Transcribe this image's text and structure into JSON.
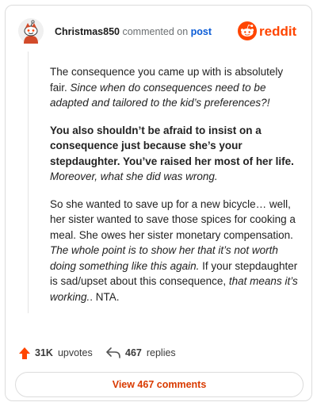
{
  "header": {
    "username": "Christmas850",
    "commented_on": "commented on",
    "post_link": "post",
    "logo_text": "reddit"
  },
  "comment": {
    "p1": {
      "t1": "The consequence you came up with is absolutely fair. ",
      "t2": "Since when do consequences need to be adapted and tailored to the kid’s preferences?!"
    },
    "p2": {
      "t1": "You also shouldn’t be afraid to insist on a consequence just because she’s your stepdaughter. You’ve raised her most of her life.",
      "t2": " Moreover, what she did was wrong."
    },
    "p3": {
      "t1": "So she wanted to save up for a new bicycle… well, her sister wanted to save those spices for cooking a meal. She owes her sister monetary compensation. ",
      "t2": "The whole point is to show her that it’s not worth doing something like this again.",
      "t3": " If your stepdaughter is sad/upset about this consequence, ",
      "t4": "that means it’s working.",
      "t5": ". NTA."
    }
  },
  "actions": {
    "upvotes": "31K",
    "upvotes_label": "upvotes",
    "replies": "467",
    "replies_label": "replies",
    "view_comments": "View 467 comments"
  },
  "colors": {
    "accent": "#ff4500",
    "link": "#0a5bd6",
    "button_text": "#d93a00"
  },
  "icons": {
    "avatar": "snoo-avatar-icon",
    "logo": "reddit-logo-icon",
    "upvote": "upvote-arrow-icon",
    "reply": "reply-arrow-icon"
  }
}
